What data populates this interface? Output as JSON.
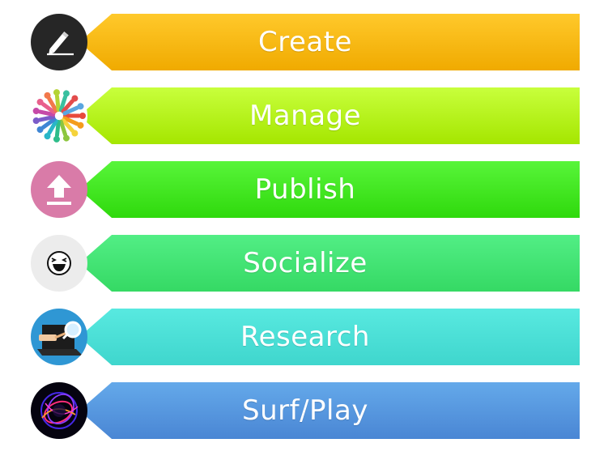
{
  "rows": [
    {
      "label": "Create",
      "icon": "pen-icon",
      "from": "#ffc92b",
      "to": "#f0aa00"
    },
    {
      "label": "Manage",
      "icon": "people-circle-icon",
      "from": "#c8ff3c",
      "to": "#a5e600"
    },
    {
      "label": "Publish",
      "icon": "upload-icon",
      "from": "#58f53a",
      "to": "#2fd90c"
    },
    {
      "label": "Socialize",
      "icon": "laughing-emoji-icon",
      "from": "#52ee85",
      "to": "#35d964"
    },
    {
      "label": "Research",
      "icon": "magnifier-laptop-icon",
      "from": "#58e9e0",
      "to": "#3fd6cd"
    },
    {
      "label": "Surf/Play",
      "icon": "light-swirl-icon",
      "from": "#64a9ea",
      "to": "#4a86d4"
    }
  ]
}
